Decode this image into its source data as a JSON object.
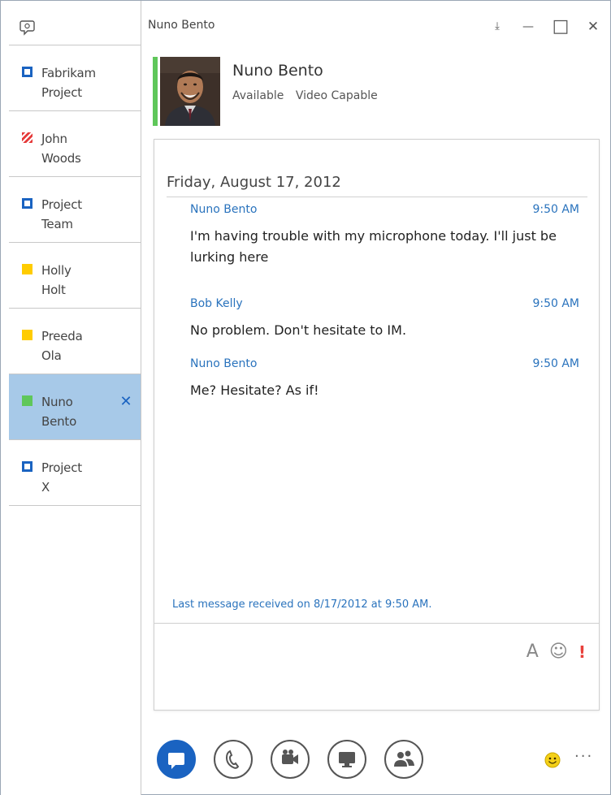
{
  "window": {
    "title": "Nuno Bento",
    "controls": {
      "popout": "⤓",
      "minimize": "—",
      "maximize": "□",
      "close": "✕"
    }
  },
  "sidebar": {
    "items": [
      {
        "label": "Fabrikam\nProject",
        "status": "im",
        "active": false
      },
      {
        "label": "John\nWoods",
        "status": "busy",
        "active": false
      },
      {
        "label": "Project\nTeam",
        "status": "im",
        "active": false
      },
      {
        "label": "Holly\nHolt",
        "status": "away",
        "active": false
      },
      {
        "label": "Preeda\nOla",
        "status": "away",
        "active": false
      },
      {
        "label": "Nuno\nBento",
        "status": "available",
        "active": true,
        "close_glyph": "✕"
      },
      {
        "label": "Project\nX",
        "status": "im",
        "active": false
      }
    ]
  },
  "contact": {
    "name": "Nuno Bento",
    "availability": "Available",
    "capability": "Video Capable",
    "presence_color": "#5fc75a"
  },
  "conversation": {
    "date": "Friday, August 17, 2012",
    "messages": [
      {
        "sender": "Nuno Bento",
        "time": "9:50 AM",
        "text": "I'm having trouble with my microphone today. I'll just be lurking here"
      },
      {
        "sender": "Bob Kelly",
        "time": "9:50 AM",
        "text": "No problem. Don't hesitate to IM."
      },
      {
        "sender": "Nuno Bento",
        "time": "9:50 AM",
        "text": "Me? Hesitate? As if!"
      }
    ],
    "last_received": "Last message received on 8/17/2012 at 9:50 AM."
  },
  "compose": {
    "font_glyph": "A",
    "emoticon_glyph": "☺",
    "urgent_glyph": "!"
  },
  "toolbar": {
    "more_label": "···",
    "accent_color": "#1a63c1"
  }
}
